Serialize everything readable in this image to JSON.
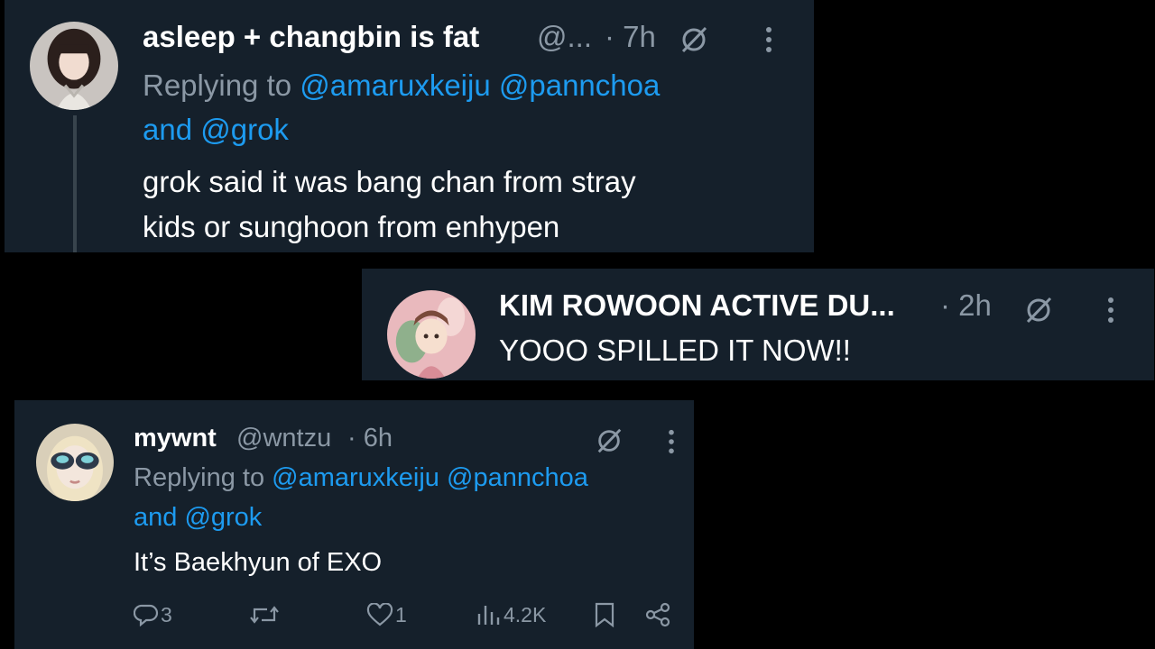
{
  "tweets": [
    {
      "display_name": "asleep + changbin is fat",
      "handle": "@...",
      "time": "· 7h",
      "reply_prefix": "Replying to",
      "mention1": "@amaruxkeiju",
      "mention2": "@pannchoa",
      "and_word": "and",
      "mention3": "@grok",
      "text_line1": "grok said it was bang chan from stray",
      "text_line2": "kids or sunghoon from enhypen"
    },
    {
      "display_name": "KIM ROWOON ACTIVE DU...",
      "time": "· 2h",
      "text": "YOOO SPILLED IT NOW!!"
    },
    {
      "display_name": "mywnt",
      "handle": "@wntzu",
      "time": "· 6h",
      "reply_prefix": "Replying to",
      "mention1": "@amaruxkeiju",
      "mention2": "@pannchoa",
      "and_word": "and",
      "mention3": "@grok",
      "text": "It’s Baekhyun of EXO",
      "actions": {
        "replies": "3",
        "retweets": "",
        "likes": "1",
        "views": "4.2K"
      }
    }
  ],
  "icons": {
    "grok": "grok-icon",
    "more": "more-vertical-icon",
    "reply": "reply-icon",
    "retweet": "retweet-icon",
    "like": "heart-icon",
    "views": "views-icon",
    "bookmark": "bookmark-icon",
    "share": "share-icon"
  },
  "colors": {
    "background": "#000000",
    "card": "#15202b",
    "text": "#ffffff",
    "secondary": "#8b98a5",
    "link": "#1d9bf0"
  }
}
